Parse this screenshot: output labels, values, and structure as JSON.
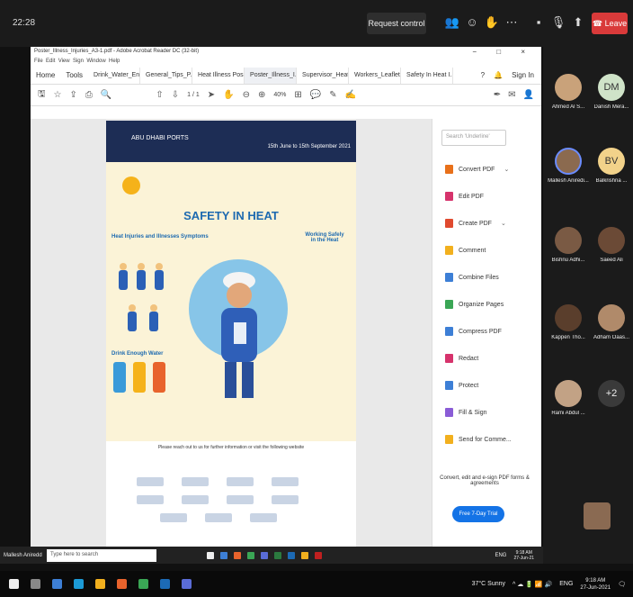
{
  "meeting": {
    "time": "22:28",
    "request_control": "Request control",
    "leave": "Leave",
    "icons": [
      "people-icon",
      "chat-icon",
      "raise-hand-icon",
      "more-icon",
      "camera-off-icon",
      "mic-off-icon",
      "share-icon",
      "leave-icon"
    ]
  },
  "acrobat": {
    "window_title": "Poster_Illness_Injuries_A3-1.pdf - Adobe Acrobat Reader DC (32-bit)",
    "menu": [
      "File",
      "Edit",
      "View",
      "Sign",
      "Window",
      "Help"
    ],
    "nav": [
      "Home",
      "Tools"
    ],
    "tabs": [
      "Drink_Water_En...",
      "General_Tips_P...",
      "Heat Illness Pos...",
      "Poster_Illness_I...",
      "Supervisor_Heat...",
      "Workers_Leaflet...",
      "Safety In Heat I..."
    ],
    "active_tab_index": 3,
    "sign_in": "Sign In",
    "page_indicator": "1 / 1",
    "zoom": "40%",
    "search_placeholder": "Search 'Underline'",
    "tools": [
      {
        "label": "Convert PDF",
        "color": "#e8701a",
        "caret": true
      },
      {
        "label": "Edit PDF",
        "color": "#d6336c",
        "caret": false
      },
      {
        "label": "Create PDF",
        "color": "#e04a2f",
        "caret": true
      },
      {
        "label": "Comment",
        "color": "#f2b01e",
        "caret": false
      },
      {
        "label": "Combine Files",
        "color": "#3d7fd6",
        "caret": false
      },
      {
        "label": "Organize Pages",
        "color": "#3aa655",
        "caret": false
      },
      {
        "label": "Compress PDF",
        "color": "#3d7fd6",
        "caret": false
      },
      {
        "label": "Redact",
        "color": "#d6336c",
        "caret": false
      },
      {
        "label": "Protect",
        "color": "#3d7fd6",
        "caret": false
      },
      {
        "label": "Fill & Sign",
        "color": "#8a5cd6",
        "caret": false
      },
      {
        "label": "Send for Comme...",
        "color": "#f2b01e",
        "caret": false
      }
    ],
    "promo_text": "Convert, edit and e-sign PDF forms & agreements",
    "promo_button": "Free 7-Day Trial"
  },
  "poster": {
    "org": "ABU DHABI PORTS",
    "dates": "15th June to 15th September 2021",
    "title": "SAFETY IN HEAT",
    "section_symptoms": "Heat Injuries and Illnesses Symptoms",
    "section_working": "Working Safely in the Heat",
    "section_drink": "Drink Enough Water",
    "footer_tip": "Please reach out to us for further information or visit the following website"
  },
  "participants": [
    {
      "name": "Ahmed Al S...",
      "avatar_color": "#c9a27a",
      "initials": ""
    },
    {
      "name": "Danish Mera...",
      "avatar_color": "#cfe3c8",
      "initials": "DM"
    },
    {
      "name": "Mallesh Aniredi...",
      "avatar_color": "#8b6a4f",
      "initials": ""
    },
    {
      "name": "Balkrishna ...",
      "avatar_color": "#f2d28a",
      "initials": "BV"
    },
    {
      "name": "Bishnu Adhi...",
      "avatar_color": "#7a5a44",
      "initials": ""
    },
    {
      "name": "Saeed Ali",
      "avatar_color": "#6b4a36",
      "initials": ""
    },
    {
      "name": "Kappen Tho...",
      "avatar_color": "#5a3e2c",
      "initials": ""
    },
    {
      "name": "Adham Oaas...",
      "avatar_color": "#b08a6a",
      "initials": ""
    },
    {
      "name": "Rami Abdul ...",
      "avatar_color": "#c2a285",
      "initials": ""
    },
    {
      "name": "",
      "avatar_color": "#3a3a3a",
      "initials": "+2"
    }
  ],
  "captured_taskbar": {
    "user": "Mallesh Aniredd",
    "search_placeholder": "Type here to search",
    "time": "9:18 AM",
    "date": "27-Jun-21",
    "lang": "ENG"
  },
  "taskbar": {
    "weather": "37°C Sunny",
    "lang": "ENG",
    "time": "9:18 AM",
    "date": "27-Jun-2021"
  }
}
